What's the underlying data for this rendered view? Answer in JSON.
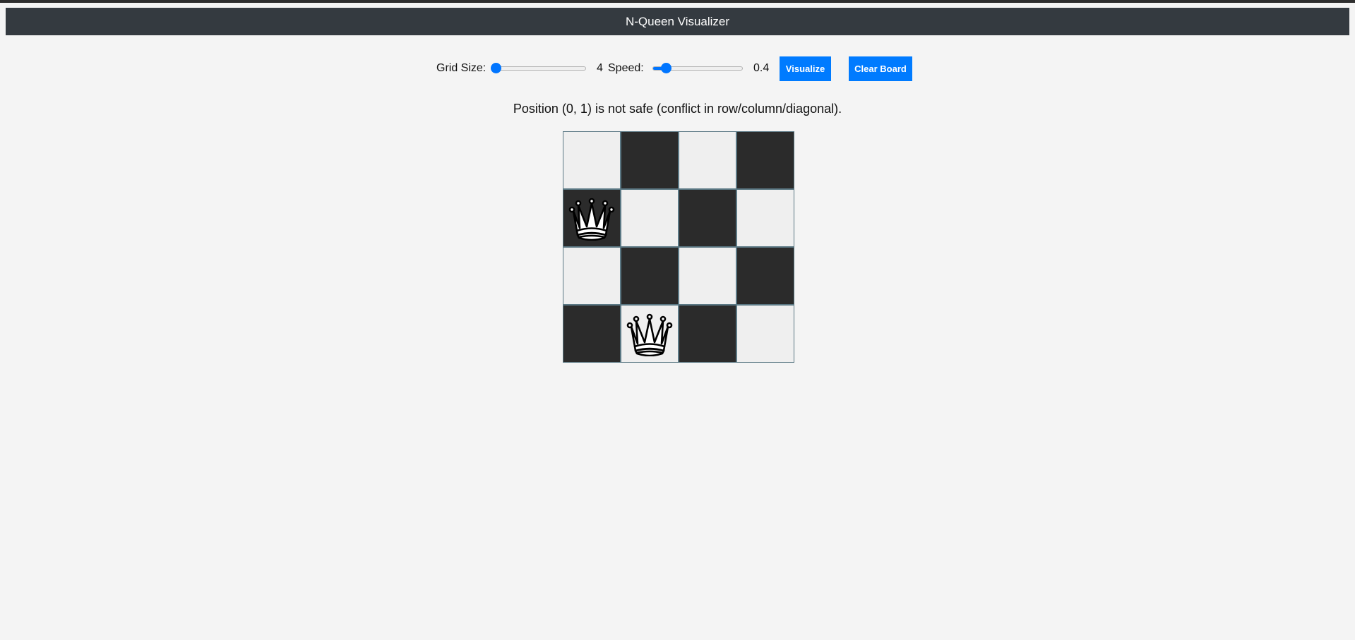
{
  "header": {
    "title": "N-Queen Visualizer"
  },
  "controls": {
    "grid_size_label": "Grid Size:",
    "grid_size_value": "4",
    "grid_size_min": 4,
    "grid_size_max": 20,
    "speed_label": "Speed:",
    "speed_value": "0.4",
    "speed_fraction": 0.15,
    "visualize_label": "Visualize",
    "clear_label": "Clear Board"
  },
  "status": {
    "message": "Position (0, 1) is not safe (conflict in row/column/diagonal)."
  },
  "board": {
    "size": 4,
    "queens": [
      {
        "row": 1,
        "col": 0
      },
      {
        "row": 3,
        "col": 1
      }
    ]
  },
  "colors": {
    "header_bg": "#343a40",
    "accent": "#007bff",
    "slider_accent": "#0075ff",
    "light_square": "#efefef",
    "dark_square": "#2b2b2b",
    "cell_border": "#5b7884",
    "page_bg": "#f4f4f4"
  },
  "icons": {
    "queen": "queen-icon"
  }
}
